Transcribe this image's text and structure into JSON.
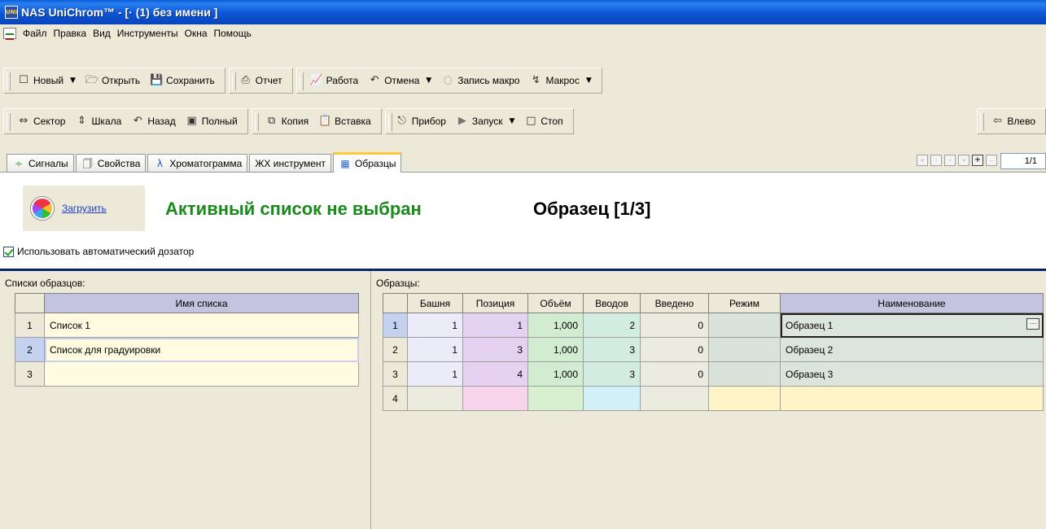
{
  "window": {
    "title": "NAS UniChrom™ - [· (1) без имени ]",
    "icon_text": "UNI"
  },
  "menu": [
    "Файл",
    "Правка",
    "Вид",
    "Инструменты",
    "Окна",
    "Помощь"
  ],
  "toolbar1": {
    "new": "Новый",
    "open": "Открыть",
    "save": "Сохранить",
    "report": "Отчет",
    "work": "Работа",
    "undo": "Отмена",
    "record_macro": "Запись макро",
    "macro": "Макрос"
  },
  "toolbar2": {
    "sector": "Сектор",
    "scale": "Шкала",
    "back": "Назад",
    "full": "Полный",
    "copy": "Копия",
    "paste": "Вставка",
    "device": "Прибор",
    "run": "Запуск",
    "stop": "Стоп",
    "left": "Влево"
  },
  "tabs": [
    {
      "label": "Сигналы",
      "icon": "signal-icon"
    },
    {
      "label": "Свойства",
      "icon": "properties-icon"
    },
    {
      "label": "Хроматограмма",
      "icon": "chromatogram-icon"
    },
    {
      "label": "ЖХ инструмент",
      "icon": ""
    },
    {
      "label": "Образцы",
      "icon": "samples-icon",
      "active": true
    }
  ],
  "pager": {
    "value": "1/1"
  },
  "samples_page": {
    "load_link": "Загрузить",
    "status": "Активный список не выбран",
    "sample_counter": "Образец [1/3]",
    "autosampler_label": "Использовать автоматический дозатор",
    "autosampler_checked": true
  },
  "lists": {
    "label": "Списки образцов:",
    "header": "Имя списка",
    "rows": [
      {
        "n": "1",
        "name": "Список 1"
      },
      {
        "n": "2",
        "name": "Список для градуировки"
      },
      {
        "n": "3",
        "name": ""
      }
    ]
  },
  "samples": {
    "label": "Образцы:",
    "headers": [
      "Башня",
      "Позиция",
      "Объём",
      "Вводов",
      "Введено",
      "Режим",
      "Наименование"
    ],
    "rows": [
      {
        "n": "1",
        "tower": "1",
        "position": "1",
        "volume": "1,000",
        "injections": "2",
        "done": "0",
        "mode": "",
        "name": "Образец 1"
      },
      {
        "n": "2",
        "tower": "1",
        "position": "3",
        "volume": "1,000",
        "injections": "3",
        "done": "0",
        "mode": "",
        "name": "Образец 2"
      },
      {
        "n": "3",
        "tower": "1",
        "position": "4",
        "volume": "1,000",
        "injections": "3",
        "done": "0",
        "mode": "",
        "name": "Образец 3"
      },
      {
        "n": "4",
        "tower": "",
        "position": "",
        "volume": "",
        "injections": "",
        "done": "",
        "mode": "",
        "name": ""
      }
    ],
    "ellipsis": "···"
  }
}
